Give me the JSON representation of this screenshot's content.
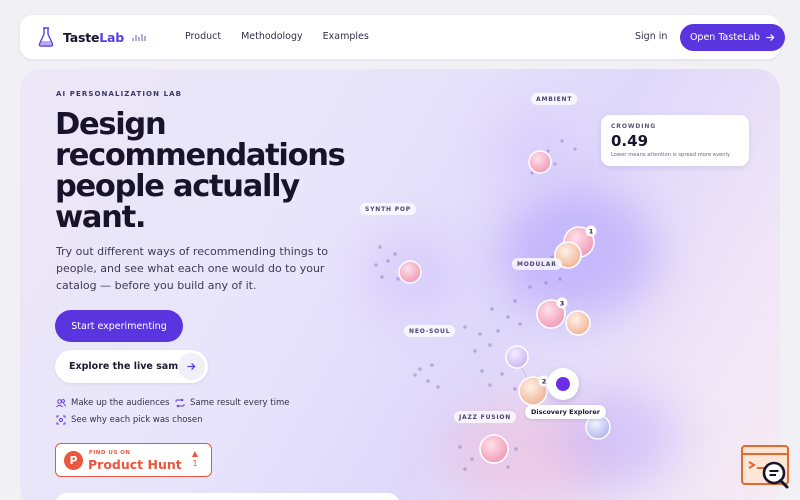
{
  "brand": {
    "name_prefix": "Taste",
    "name_suffix": "Lab"
  },
  "nav": {
    "links": [
      "Product",
      "Methodology",
      "Examples"
    ],
    "sign_in": "Sign in",
    "cta": "Open TasteLab"
  },
  "hero": {
    "eyebrow": "AI PERSONALIZATION LAB",
    "headline": [
      "Design",
      "recommendations",
      "people actually",
      "want."
    ],
    "subtext": "Try out different ways of recommending things to people, and see what each one would do to your catalog — before you build any of it.",
    "primary_cta": "Start experimenting",
    "secondary_cta": "Explore the live sample",
    "features": [
      "Make up the audiences",
      "Same result every time",
      "See why each pick was chosen"
    ]
  },
  "product_hunt": {
    "kicker": "FIND US ON",
    "name": "Product Hunt",
    "upvotes": "1"
  },
  "map": {
    "labels": [
      "AMBIENT",
      "SYNTH POP",
      "MODULAR",
      "NEO-SOUL",
      "JAZZ FUSION"
    ],
    "crowding": {
      "label": "CROWDING",
      "value": "0.49",
      "note": "Lower means attention is spread more evenly"
    },
    "rank_badges": [
      "1",
      "3",
      "2"
    ],
    "explorer_label": "Discovery Explorer"
  },
  "icons": [
    "flask-icon",
    "signal-bars-icon",
    "arrow-right-icon",
    "users-icon",
    "repeat-icon",
    "scan-icon",
    "product-hunt-logo-icon",
    "upvote-triangle-icon",
    "chat-support-icon"
  ],
  "colors": {
    "accent": "#5a34de",
    "product_hunt": "#e9573f",
    "explorer_dot": "#6a2fe6"
  }
}
